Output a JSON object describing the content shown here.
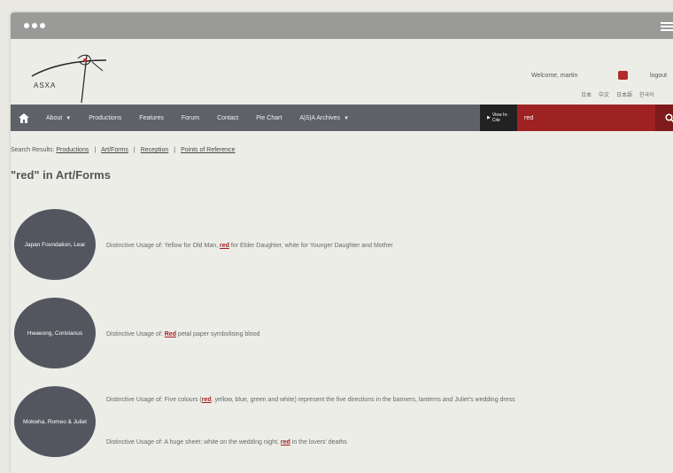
{
  "header": {
    "logo_text": "ASXA",
    "welcome": "Welcome, martin",
    "logout": "logout",
    "languages": [
      "日本",
      "中文",
      "日本語",
      "한국어"
    ]
  },
  "nav": {
    "items": [
      {
        "label": "About",
        "dropdown": true
      },
      {
        "label": "Productions",
        "dropdown": false
      },
      {
        "label": "Features",
        "dropdown": false
      },
      {
        "label": "Forum",
        "dropdown": false
      },
      {
        "label": "Contact",
        "dropdown": false
      },
      {
        "label": "Pie Chart",
        "dropdown": false
      },
      {
        "label": "A|S|A Archives",
        "dropdown": true
      }
    ],
    "view_btn": "View In-Cite",
    "search_value": "red"
  },
  "breadcrumb": {
    "prefix": "Search Results:",
    "links": [
      "Productions",
      "Art/Forms",
      "Reception",
      "Points of Reference"
    ]
  },
  "heading": "\"red\" in Art/Forms",
  "results": [
    {
      "circle": "Japan Foundation, Lear",
      "lines": [
        [
          "Distinctive Usage of: Yellow for Old Man, ",
          "red",
          " for Elder Daughter, white for Younger Daughter and Mother"
        ]
      ]
    },
    {
      "circle": "Hwaeong, Coriolanus",
      "lines": [
        [
          "Distinctive Usage of: ",
          "Red",
          " petal paper symbolising blood"
        ]
      ]
    },
    {
      "circle": "Mokwha, Romeo & Juliet",
      "lines": [
        [
          "Distinctive Usage of: Five colours (",
          "red",
          ", yellow, blue, green and white) represent the five directions in the banners, lanterns and Juliet's wedding dress"
        ],
        [
          "Distinctive Usage of: A huge sheet: white on the wedding night, ",
          "red",
          " in the lovers' deaths"
        ]
      ]
    }
  ],
  "colors": {
    "nav_bg": "#5f6169",
    "search_bg": "#9e2222",
    "highlight": "#a32020",
    "circle_bg": "#53565f"
  }
}
